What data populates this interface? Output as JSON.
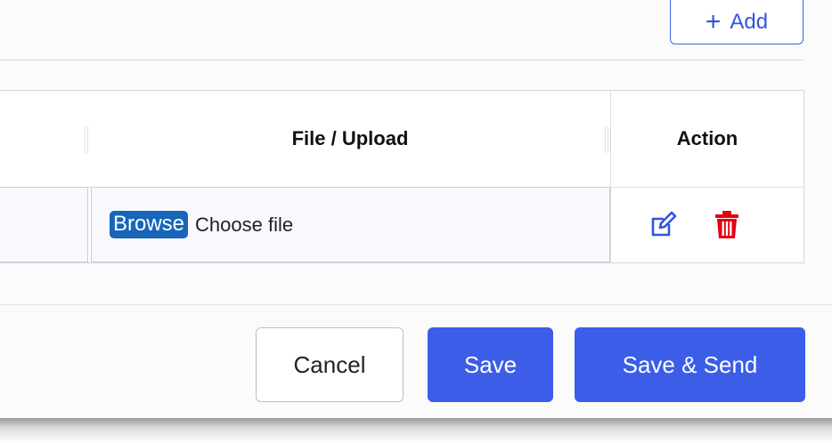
{
  "toolbar": {
    "add_label": "Add",
    "add_icon": "plus-icon"
  },
  "table": {
    "columns": [
      "",
      "File / Upload",
      "Action"
    ],
    "rows": [
      {
        "browse_label": "Browse",
        "file_placeholder": "Choose file",
        "actions": [
          "edit-icon",
          "trash-icon"
        ]
      }
    ]
  },
  "footer": {
    "cancel_label": "Cancel",
    "save_label": "Save",
    "save_send_label": "Save & Send"
  },
  "colors": {
    "primary": "#3b5de7",
    "browse": "#1766b9",
    "edit_icon": "#2f56e0",
    "delete_icon": "#e3000f"
  }
}
